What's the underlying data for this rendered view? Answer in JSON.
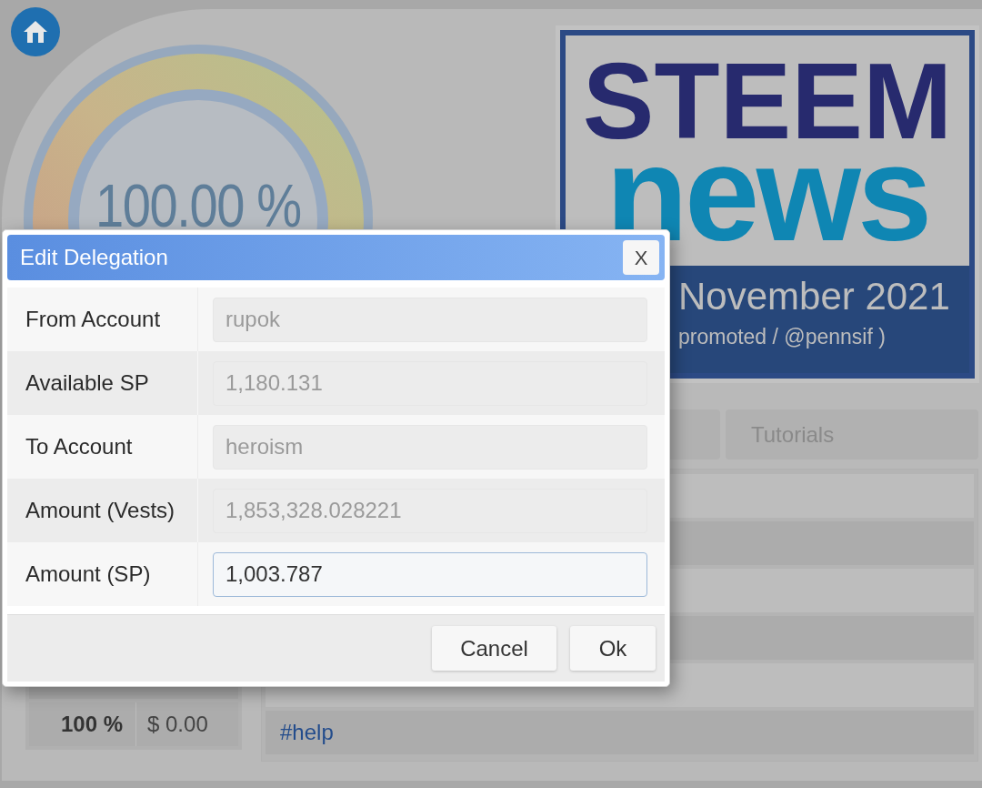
{
  "gauge": {
    "reading": "100.00 %"
  },
  "banner": {
    "title_top": "STEEM",
    "title_bottom": "news",
    "month": "November 2021",
    "credit": "promoted / @pennsif )"
  },
  "tabs": [
    {
      "label": "Tutorials"
    }
  ],
  "tag_list": [
    {
      "text": "#help"
    }
  ],
  "payout_table": [
    {
      "percent": "100 %",
      "value": "$ 0.00"
    }
  ],
  "dialog": {
    "title": "Edit Delegation",
    "close": "X",
    "fields": [
      {
        "label": "From Account",
        "value": "rupok",
        "disabled": true
      },
      {
        "label": "Available SP",
        "value": "1,180.131",
        "disabled": true
      },
      {
        "label": "To Account",
        "value": "heroism",
        "disabled": true
      },
      {
        "label": "Amount (Vests)",
        "value": "1,853,328.028221",
        "disabled": true
      },
      {
        "label": "Amount (SP)",
        "value": "1,003.787",
        "disabled": false
      }
    ],
    "buttons": [
      "Cancel",
      "Ok"
    ]
  }
}
